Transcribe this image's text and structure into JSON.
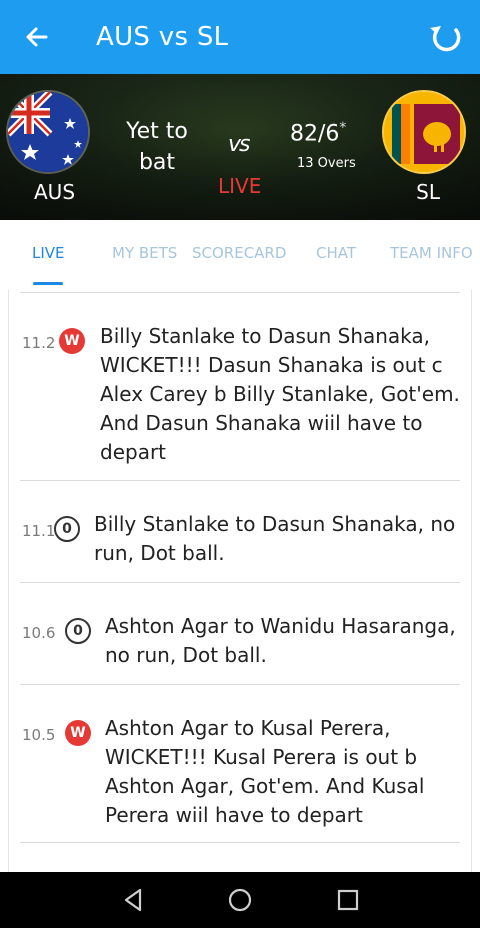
{
  "app_bar": {
    "title": "AUS vs SL",
    "back_icon": "arrow-left-icon",
    "refresh_icon": "refresh-icon",
    "background": "#1e9cf0"
  },
  "scoreboard": {
    "team1": {
      "code": "AUS",
      "status": "Yet to bat",
      "flag_icon": "australia-flag-icon"
    },
    "team2": {
      "code": "SL",
      "score": "82/6",
      "score_marker": "*",
      "overs": "13 Overs",
      "flag_icon": "sri-lanka-flag-icon"
    },
    "vs_label": "vs",
    "live_label": "LIVE",
    "live_color": "#e53935"
  },
  "tabs": [
    {
      "label": "LIVE",
      "active": true
    },
    {
      "label": "MY BETS",
      "active": false
    },
    {
      "label": "SCORECARD",
      "active": false
    },
    {
      "label": "CHAT",
      "active": false
    },
    {
      "label": "TEAM INFO",
      "active": false
    }
  ],
  "commentary": [
    {
      "over": "11.2",
      "badge": "W",
      "badge_type": "wicket",
      "text": "Billy Stanlake to Dasun Shanaka, WICKET!!! Dasun Shanaka is out c Alex Carey b Billy Stanlake, Got'em. And Dasun Shanaka wiil have to depart"
    },
    {
      "over": "11.1",
      "badge": "0",
      "badge_type": "dot",
      "text": "Billy Stanlake to Dasun Shanaka, no run, Dot ball."
    },
    {
      "over": "10.6",
      "badge": "0",
      "badge_type": "dot",
      "text": "Ashton Agar to Wanidu Hasaranga, no run, Dot ball."
    },
    {
      "over": "10.5",
      "badge": "W",
      "badge_type": "wicket",
      "text": "Ashton Agar to Kusal Perera, WICKET!!! Kusal Perera is out b Ashton Agar, Got'em. And Kusal Perera wiil have to depart"
    }
  ],
  "nav_bar": {
    "back_icon": "triangle-back-icon",
    "home_icon": "circle-home-icon",
    "recents_icon": "square-recents-icon"
  }
}
